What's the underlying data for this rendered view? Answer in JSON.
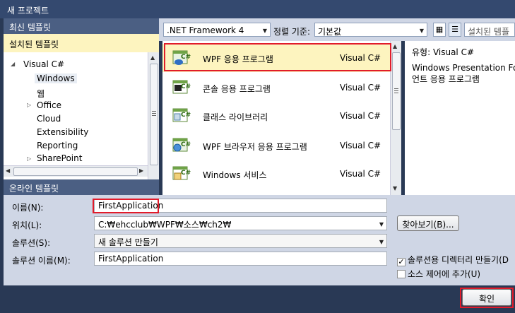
{
  "window": {
    "title": "새 프로젝트"
  },
  "left_panel": {
    "recent_header": "최신 템플릿",
    "installed_header": "설치된 템플릿",
    "tree": {
      "root": "Visual C#",
      "items": [
        "Windows",
        "웹",
        "Office",
        "Cloud",
        "Extensibility",
        "Reporting",
        "SharePoint"
      ]
    },
    "online_header": "온라인 템플릿"
  },
  "toolbar": {
    "framework": ".NET Framework 4",
    "sort_label": "정렬 기준:",
    "sort_value": "기본값",
    "search_placeholder": "설치된 템플"
  },
  "templates": [
    {
      "name": "WPF 응용 프로그램",
      "lang": "Visual C#",
      "icon": "wpf-app-icon"
    },
    {
      "name": "콘솔 응용 프로그램",
      "lang": "Visual C#",
      "icon": "console-app-icon"
    },
    {
      "name": "클래스 라이브러리",
      "lang": "Visual C#",
      "icon": "class-library-icon"
    },
    {
      "name": "WPF 브라우저 응용 프로그램",
      "lang": "Visual C#",
      "icon": "wpf-browser-icon"
    },
    {
      "name": "Windows 서비스",
      "lang": "Visual C#",
      "icon": "windows-service-icon"
    }
  ],
  "info": {
    "type_line": "유형:  Visual C#",
    "desc_1": "Windows Presentation Foun",
    "desc_2": "언트 응용 프로그램"
  },
  "form": {
    "name_label": "이름(N):",
    "name_value": "FirstApplication",
    "location_label": "위치(L):",
    "location_value": "C:₩ehcclub₩WPF₩소스₩ch2₩",
    "browse_label": "찾아보기(B)...",
    "solution_label": "솔루션(S):",
    "solution_value": "새 솔루션 만들기",
    "solution_name_label": "솔루션 이름(M):",
    "solution_name_value": "FirstApplication",
    "create_dir_label": "솔루션용 디렉터리 만들기(D",
    "create_dir_checked": true,
    "source_control_label": "소스 제어에 추가(U)",
    "source_control_checked": false
  },
  "footer": {
    "ok_label": "확인"
  },
  "colors": {
    "highlight": "#e11b2a",
    "selected_bg": "#fdf4bf",
    "header_bg": "#4b5f83"
  }
}
